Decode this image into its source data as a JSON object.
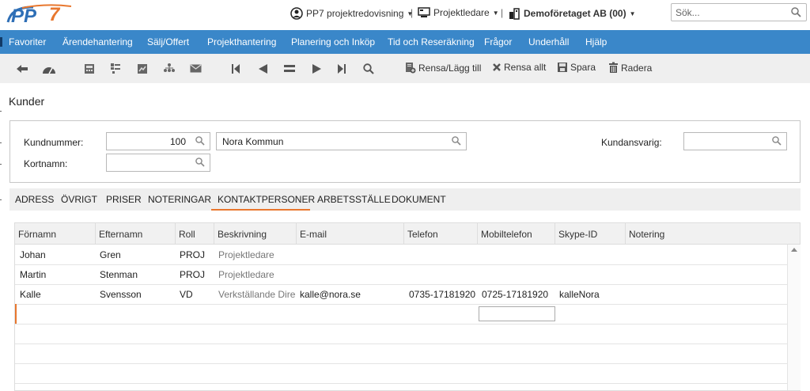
{
  "header": {
    "logo_text": "PP7",
    "product": "PP7 projektredovisning",
    "role": "Projektledare",
    "company": "Demoföretaget AB (00)",
    "search_placeholder": "Sök...",
    "separator": "|"
  },
  "nav": {
    "items": [
      "Favoriter",
      "Ärendehantering",
      "Sälj/Offert",
      "Projekthantering",
      "Planering och Inköp",
      "Tid och Reseräkning",
      "Frågor",
      "Underhåll",
      "Hjälp"
    ]
  },
  "toolbar": {
    "rensa_lagg_till": "Rensa/Lägg till",
    "rensa_allt": "Rensa allt",
    "spara": "Spara",
    "radera": "Radera"
  },
  "page": {
    "title": "Kunder"
  },
  "form": {
    "kundnummer_label": "Kundnummer:",
    "kundnummer_value": "100",
    "kundnamn_value": "Nora Kommun",
    "kortnamn_label": "Kortnamn:",
    "kortnamn_value": "",
    "kundansvarig_label": "Kundansvarig:",
    "kundansvarig_value": ""
  },
  "tabs": [
    "ADRESS",
    "ÖVRIGT",
    "PRISER",
    "NOTERINGAR",
    "KONTAKTPERSONER",
    "ARBETSSTÄLLE",
    "DOKUMENT"
  ],
  "active_tab": "KONTAKTPERSONER",
  "grid": {
    "columns": [
      "Förnamn",
      "Efternamn",
      "Roll",
      "Beskrivning",
      "E-mail",
      "Telefon",
      "Mobiltelefon",
      "Skype-ID",
      "Notering"
    ],
    "rows": [
      [
        "Johan",
        "Gren",
        "PROJ",
        "Projektledare",
        "",
        "",
        "",
        "",
        ""
      ],
      [
        "Martin",
        "Stenman",
        "PROJ",
        "Projektledare",
        "",
        "",
        "",
        "",
        ""
      ],
      [
        "Kalle",
        "Svensson",
        "VD",
        "Verkställande Direktör",
        "kalle@nora.se",
        "0735-17181920",
        "0725-17181920",
        "kalleNora",
        ""
      ]
    ]
  },
  "colors": {
    "nav_bg": "#3a87c9",
    "accent": "#e8772e",
    "logo_blue": "#2f6fb6",
    "logo_orange": "#e8772e"
  }
}
